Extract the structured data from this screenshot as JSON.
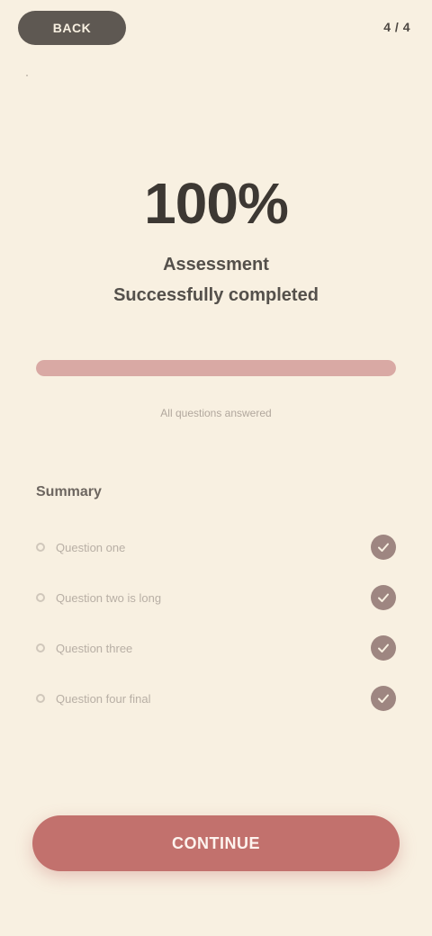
{
  "header": {
    "back_label": "BACK",
    "step_label": "4 / 4",
    "caption": "·"
  },
  "result": {
    "score": "100%",
    "title": "Assessment",
    "subtitle": "Successfully completed"
  },
  "progress": {
    "value": 1.0,
    "caption": "All questions answered"
  },
  "summary": {
    "heading": "Summary",
    "items": [
      {
        "label": "Question one",
        "checked": true
      },
      {
        "label": "Question two is long",
        "checked": true
      },
      {
        "label": "Question three",
        "checked": true
      },
      {
        "label": "Question four final",
        "checked": true
      }
    ]
  },
  "cta": {
    "label": "CONTINUE"
  },
  "colors": {
    "background": "#f8f0e1",
    "accent": "#c2716d",
    "progress": "#d9a9a4",
    "check": "#9e8681"
  }
}
